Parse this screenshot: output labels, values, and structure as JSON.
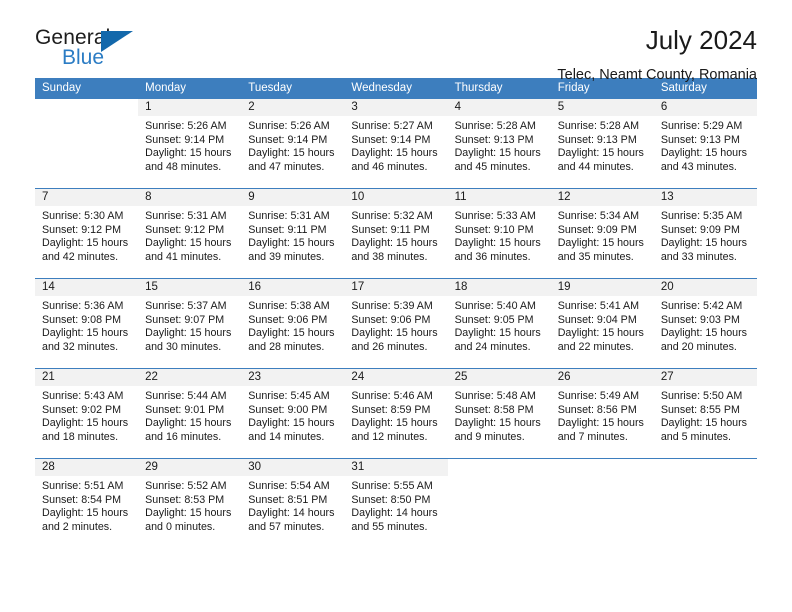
{
  "brand": {
    "name_top": "General",
    "name_bottom": "Blue",
    "accent_color": "#2b7cc4",
    "triangle_color": "#1368ab"
  },
  "header": {
    "title": "July 2024",
    "subtitle": "Telec, Neamt County, Romania",
    "header_bg": "#3d7ebe"
  },
  "calendar": {
    "weekdays": [
      "Sunday",
      "Monday",
      "Tuesday",
      "Wednesday",
      "Thursday",
      "Friday",
      "Saturday"
    ],
    "weeks": [
      [
        {
          "day": "",
          "lines": []
        },
        {
          "day": "1",
          "lines": [
            "Sunrise: 5:26 AM",
            "Sunset: 9:14 PM",
            "Daylight: 15 hours",
            "and 48 minutes."
          ]
        },
        {
          "day": "2",
          "lines": [
            "Sunrise: 5:26 AM",
            "Sunset: 9:14 PM",
            "Daylight: 15 hours",
            "and 47 minutes."
          ]
        },
        {
          "day": "3",
          "lines": [
            "Sunrise: 5:27 AM",
            "Sunset: 9:14 PM",
            "Daylight: 15 hours",
            "and 46 minutes."
          ]
        },
        {
          "day": "4",
          "lines": [
            "Sunrise: 5:28 AM",
            "Sunset: 9:13 PM",
            "Daylight: 15 hours",
            "and 45 minutes."
          ]
        },
        {
          "day": "5",
          "lines": [
            "Sunrise: 5:28 AM",
            "Sunset: 9:13 PM",
            "Daylight: 15 hours",
            "and 44 minutes."
          ]
        },
        {
          "day": "6",
          "lines": [
            "Sunrise: 5:29 AM",
            "Sunset: 9:13 PM",
            "Daylight: 15 hours",
            "and 43 minutes."
          ]
        }
      ],
      [
        {
          "day": "7",
          "lines": [
            "Sunrise: 5:30 AM",
            "Sunset: 9:12 PM",
            "Daylight: 15 hours",
            "and 42 minutes."
          ]
        },
        {
          "day": "8",
          "lines": [
            "Sunrise: 5:31 AM",
            "Sunset: 9:12 PM",
            "Daylight: 15 hours",
            "and 41 minutes."
          ]
        },
        {
          "day": "9",
          "lines": [
            "Sunrise: 5:31 AM",
            "Sunset: 9:11 PM",
            "Daylight: 15 hours",
            "and 39 minutes."
          ]
        },
        {
          "day": "10",
          "lines": [
            "Sunrise: 5:32 AM",
            "Sunset: 9:11 PM",
            "Daylight: 15 hours",
            "and 38 minutes."
          ]
        },
        {
          "day": "11",
          "lines": [
            "Sunrise: 5:33 AM",
            "Sunset: 9:10 PM",
            "Daylight: 15 hours",
            "and 36 minutes."
          ]
        },
        {
          "day": "12",
          "lines": [
            "Sunrise: 5:34 AM",
            "Sunset: 9:09 PM",
            "Daylight: 15 hours",
            "and 35 minutes."
          ]
        },
        {
          "day": "13",
          "lines": [
            "Sunrise: 5:35 AM",
            "Sunset: 9:09 PM",
            "Daylight: 15 hours",
            "and 33 minutes."
          ]
        }
      ],
      [
        {
          "day": "14",
          "lines": [
            "Sunrise: 5:36 AM",
            "Sunset: 9:08 PM",
            "Daylight: 15 hours",
            "and 32 minutes."
          ]
        },
        {
          "day": "15",
          "lines": [
            "Sunrise: 5:37 AM",
            "Sunset: 9:07 PM",
            "Daylight: 15 hours",
            "and 30 minutes."
          ]
        },
        {
          "day": "16",
          "lines": [
            "Sunrise: 5:38 AM",
            "Sunset: 9:06 PM",
            "Daylight: 15 hours",
            "and 28 minutes."
          ]
        },
        {
          "day": "17",
          "lines": [
            "Sunrise: 5:39 AM",
            "Sunset: 9:06 PM",
            "Daylight: 15 hours",
            "and 26 minutes."
          ]
        },
        {
          "day": "18",
          "lines": [
            "Sunrise: 5:40 AM",
            "Sunset: 9:05 PM",
            "Daylight: 15 hours",
            "and 24 minutes."
          ]
        },
        {
          "day": "19",
          "lines": [
            "Sunrise: 5:41 AM",
            "Sunset: 9:04 PM",
            "Daylight: 15 hours",
            "and 22 minutes."
          ]
        },
        {
          "day": "20",
          "lines": [
            "Sunrise: 5:42 AM",
            "Sunset: 9:03 PM",
            "Daylight: 15 hours",
            "and 20 minutes."
          ]
        }
      ],
      [
        {
          "day": "21",
          "lines": [
            "Sunrise: 5:43 AM",
            "Sunset: 9:02 PM",
            "Daylight: 15 hours",
            "and 18 minutes."
          ]
        },
        {
          "day": "22",
          "lines": [
            "Sunrise: 5:44 AM",
            "Sunset: 9:01 PM",
            "Daylight: 15 hours",
            "and 16 minutes."
          ]
        },
        {
          "day": "23",
          "lines": [
            "Sunrise: 5:45 AM",
            "Sunset: 9:00 PM",
            "Daylight: 15 hours",
            "and 14 minutes."
          ]
        },
        {
          "day": "24",
          "lines": [
            "Sunrise: 5:46 AM",
            "Sunset: 8:59 PM",
            "Daylight: 15 hours",
            "and 12 minutes."
          ]
        },
        {
          "day": "25",
          "lines": [
            "Sunrise: 5:48 AM",
            "Sunset: 8:58 PM",
            "Daylight: 15 hours",
            "and 9 minutes."
          ]
        },
        {
          "day": "26",
          "lines": [
            "Sunrise: 5:49 AM",
            "Sunset: 8:56 PM",
            "Daylight: 15 hours",
            "and 7 minutes."
          ]
        },
        {
          "day": "27",
          "lines": [
            "Sunrise: 5:50 AM",
            "Sunset: 8:55 PM",
            "Daylight: 15 hours",
            "and 5 minutes."
          ]
        }
      ],
      [
        {
          "day": "28",
          "lines": [
            "Sunrise: 5:51 AM",
            "Sunset: 8:54 PM",
            "Daylight: 15 hours",
            "and 2 minutes."
          ]
        },
        {
          "day": "29",
          "lines": [
            "Sunrise: 5:52 AM",
            "Sunset: 8:53 PM",
            "Daylight: 15 hours",
            "and 0 minutes."
          ]
        },
        {
          "day": "30",
          "lines": [
            "Sunrise: 5:54 AM",
            "Sunset: 8:51 PM",
            "Daylight: 14 hours",
            "and 57 minutes."
          ]
        },
        {
          "day": "31",
          "lines": [
            "Sunrise: 5:55 AM",
            "Sunset: 8:50 PM",
            "Daylight: 14 hours",
            "and 55 minutes."
          ]
        },
        {
          "day": "",
          "lines": []
        },
        {
          "day": "",
          "lines": []
        },
        {
          "day": "",
          "lines": []
        }
      ]
    ]
  }
}
